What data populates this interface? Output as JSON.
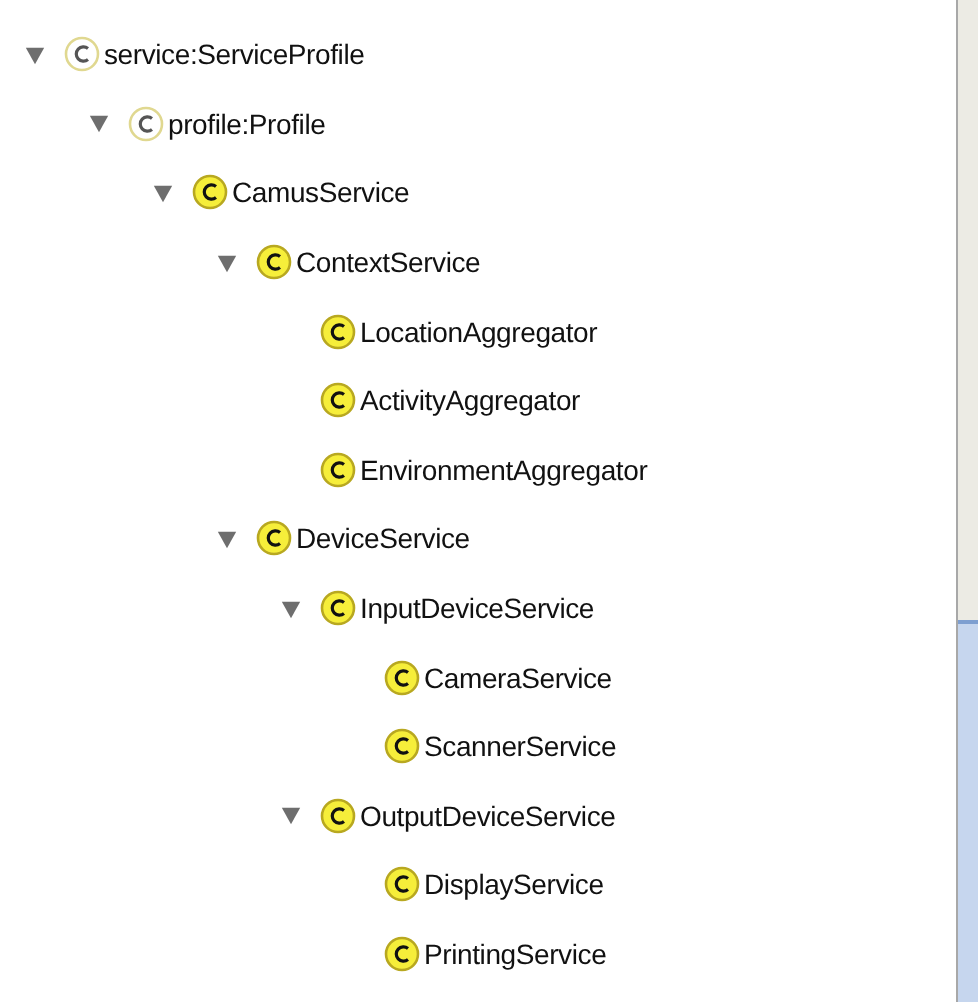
{
  "tree": [
    {
      "label": "service:ServiceProfile",
      "kind": "plain",
      "expanded": true,
      "children": [
        {
          "label": "profile:Profile",
          "kind": "plain",
          "expanded": true,
          "children": [
            {
              "label": "CamusService",
              "kind": "filled",
              "expanded": true,
              "children": [
                {
                  "label": "ContextService",
                  "kind": "filled",
                  "expanded": true,
                  "children": [
                    {
                      "label": "LocationAggregator",
                      "kind": "filled"
                    },
                    {
                      "label": "ActivityAggregator",
                      "kind": "filled"
                    },
                    {
                      "label": "EnvironmentAggregator",
                      "kind": "filled"
                    }
                  ]
                },
                {
                  "label": "DeviceService",
                  "kind": "filled",
                  "expanded": true,
                  "children": [
                    {
                      "label": "InputDeviceService",
                      "kind": "filled",
                      "expanded": true,
                      "children": [
                        {
                          "label": "CameraService",
                          "kind": "filled"
                        },
                        {
                          "label": "ScannerService",
                          "kind": "filled"
                        }
                      ]
                    },
                    {
                      "label": "OutputDeviceService",
                      "kind": "filled",
                      "expanded": true,
                      "children": [
                        {
                          "label": "DisplayService",
                          "kind": "filled"
                        },
                        {
                          "label": "PrintingService",
                          "kind": "filled"
                        }
                      ]
                    }
                  ]
                }
              ]
            }
          ]
        }
      ]
    }
  ]
}
